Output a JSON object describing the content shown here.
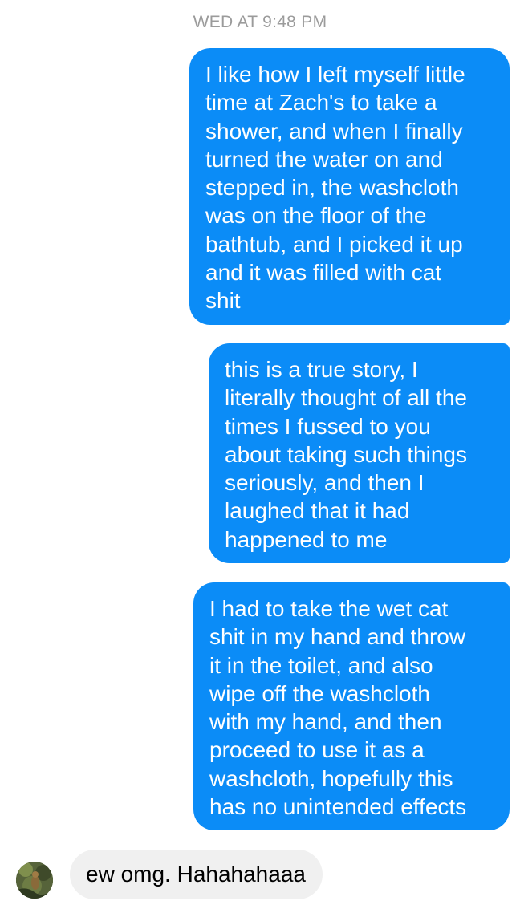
{
  "conversation": {
    "timestamp": "WED AT 9:48 PM",
    "outgoing": [
      {
        "text": "I like how I left myself little\ntime at Zach's to take a\nshower, and when I finally\nturned the water on and\nstepped in, the washcloth\nwas on the floor of the\nbathtub, and I picked it up\nand it was filled with cat\nshit"
      },
      {
        "text": "this is a true story, I\nliterally thought of all the\ntimes I fussed to you\nabout taking such things\nseriously, and then I\nlaughed that it had\nhappened to me"
      },
      {
        "text": "I had to take the wet cat\nshit in my hand and throw\nit in the toilet, and also\nwipe off the washcloth\nwith my hand, and then\nproceed to use it as a\nwashcloth, hopefully this\nhas no unintended effects"
      }
    ],
    "incoming": [
      {
        "text": "ew omg. Hahahahaaa",
        "avatar_icon": "contact-avatar-photo"
      }
    ]
  },
  "colors": {
    "outgoing_bubble": "#0b8cf7",
    "incoming_bubble": "#f0f0f0",
    "timestamp_text": "#9b9b9b"
  }
}
